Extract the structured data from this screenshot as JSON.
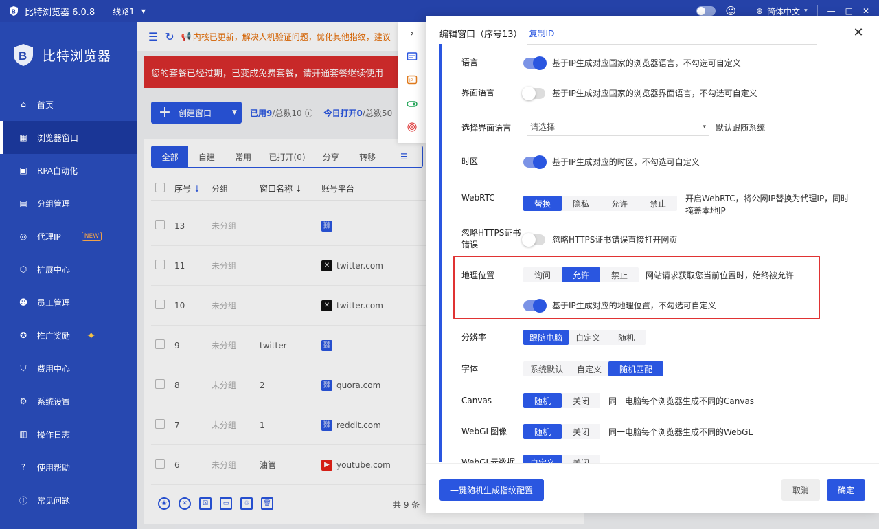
{
  "titlebar": {
    "app_title": "比特浏览器 6.0.8",
    "line": "线路1",
    "language": "简体中文",
    "controls": [
      "—",
      "□",
      "✕"
    ]
  },
  "sidebar": {
    "brand": "比特浏览器",
    "items": [
      {
        "label": "首页",
        "icon": "home-icon"
      },
      {
        "label": "浏览器窗口",
        "icon": "grid-icon",
        "active": true
      },
      {
        "label": "RPA自动化",
        "icon": "rpa-icon"
      },
      {
        "label": "分组管理",
        "icon": "group-icon"
      },
      {
        "label": "代理IP",
        "icon": "location-icon",
        "badge": "NEW"
      },
      {
        "label": "扩展中心",
        "icon": "cube-icon"
      },
      {
        "label": "员工管理",
        "icon": "staff-icon"
      },
      {
        "label": "推广奖励",
        "icon": "reward-icon"
      },
      {
        "label": "费用中心",
        "icon": "shield-icon"
      },
      {
        "label": "系统设置",
        "icon": "gear-icon"
      },
      {
        "label": "操作日志",
        "icon": "log-icon"
      },
      {
        "label": "使用帮助",
        "icon": "help-icon"
      },
      {
        "label": "常见问题",
        "icon": "info-icon"
      }
    ]
  },
  "main": {
    "notice": "内核已更新，解决人机验证问题，优化其他指纹，建议",
    "expired": "您的套餐已经过期，已变成免费套餐，请开通套餐继续使用",
    "create_label": "创建窗口",
    "usage_used": "已用9",
    "usage_total": "/总数10",
    "today_open": "今日打开0",
    "today_total": "/总数50",
    "tabs": [
      "全部",
      "自建",
      "常用",
      "已打开(0)",
      "分享",
      "转移"
    ],
    "columns": [
      "序号",
      "分组",
      "窗口名称",
      "账号平台"
    ],
    "rows": [
      {
        "num": "13",
        "group": "未分组",
        "name": "",
        "platform": "",
        "icon": "link"
      },
      {
        "num": "11",
        "group": "未分组",
        "name": "",
        "platform": "twitter.com",
        "icon": "x"
      },
      {
        "num": "10",
        "group": "未分组",
        "name": "",
        "platform": "twitter.com",
        "icon": "x"
      },
      {
        "num": "9",
        "group": "未分组",
        "name": "twitter",
        "platform": "",
        "icon": "link"
      },
      {
        "num": "8",
        "group": "未分组",
        "name": "2",
        "platform": "quora.com",
        "icon": "link"
      },
      {
        "num": "7",
        "group": "未分组",
        "name": "1",
        "platform": "reddit.com",
        "icon": "link"
      },
      {
        "num": "6",
        "group": "未分组",
        "name": "油管",
        "platform": "youtube.com",
        "icon": "yt"
      }
    ],
    "total": "共 9 条"
  },
  "modal": {
    "title": "编辑窗口（序号13）",
    "copy_id": "复制ID",
    "fields": {
      "language": {
        "label": "语言",
        "desc": "基于IP生成对应国家的浏览器语言，不勾选可自定义"
      },
      "ui_language": {
        "label": "界面语言",
        "desc": "基于IP生成对应国家的浏览器界面语言，不勾选可自定义"
      },
      "select_ui_language": {
        "label": "选择界面语言",
        "placeholder": "请选择",
        "desc": "默认跟随系统"
      },
      "timezone": {
        "label": "时区",
        "desc": "基于IP生成对应的时区，不勾选可自定义"
      },
      "webrtc": {
        "label": "WebRTC",
        "options": [
          "替换",
          "隐私",
          "允许",
          "禁止"
        ],
        "selected": "替换",
        "desc_line1": "开启WebRTC，将公网IP替换为代理IP，同时",
        "desc_line2": "掩盖本地IP"
      },
      "https": {
        "label_line1": "忽略HTTPS证书",
        "label_line2": "错误",
        "desc": "忽略HTTPS证书错误直接打开网页"
      },
      "geo": {
        "label": "地理位置",
        "options": [
          "询问",
          "允许",
          "禁止"
        ],
        "selected": "允许",
        "desc": "网站请求获取您当前位置时，始终被允许",
        "sub_desc": "基于IP生成对应的地理位置，不勾选可自定义"
      },
      "resolution": {
        "label": "分辨率",
        "options": [
          "跟随电脑",
          "自定义",
          "随机"
        ],
        "selected": "跟随电脑"
      },
      "font": {
        "label": "字体",
        "options": [
          "系统默认",
          "自定义",
          "随机匹配"
        ],
        "selected": "随机匹配"
      },
      "canvas": {
        "label": "Canvas",
        "options": [
          "随机",
          "关闭"
        ],
        "selected": "随机",
        "desc": "同一电脑每个浏览器生成不同的Canvas"
      },
      "webgl_image": {
        "label": "WebGL图像",
        "options": [
          "随机",
          "关闭"
        ],
        "selected": "随机",
        "desc": "同一电脑每个浏览器生成不同的WebGL"
      },
      "webgl_meta": {
        "label": "WebGL元数据",
        "options": [
          "自定义",
          "关闭"
        ],
        "selected": "自定义"
      }
    },
    "random_btn": "一键随机生成指纹配置",
    "cancel": "取消",
    "ok": "确定"
  }
}
